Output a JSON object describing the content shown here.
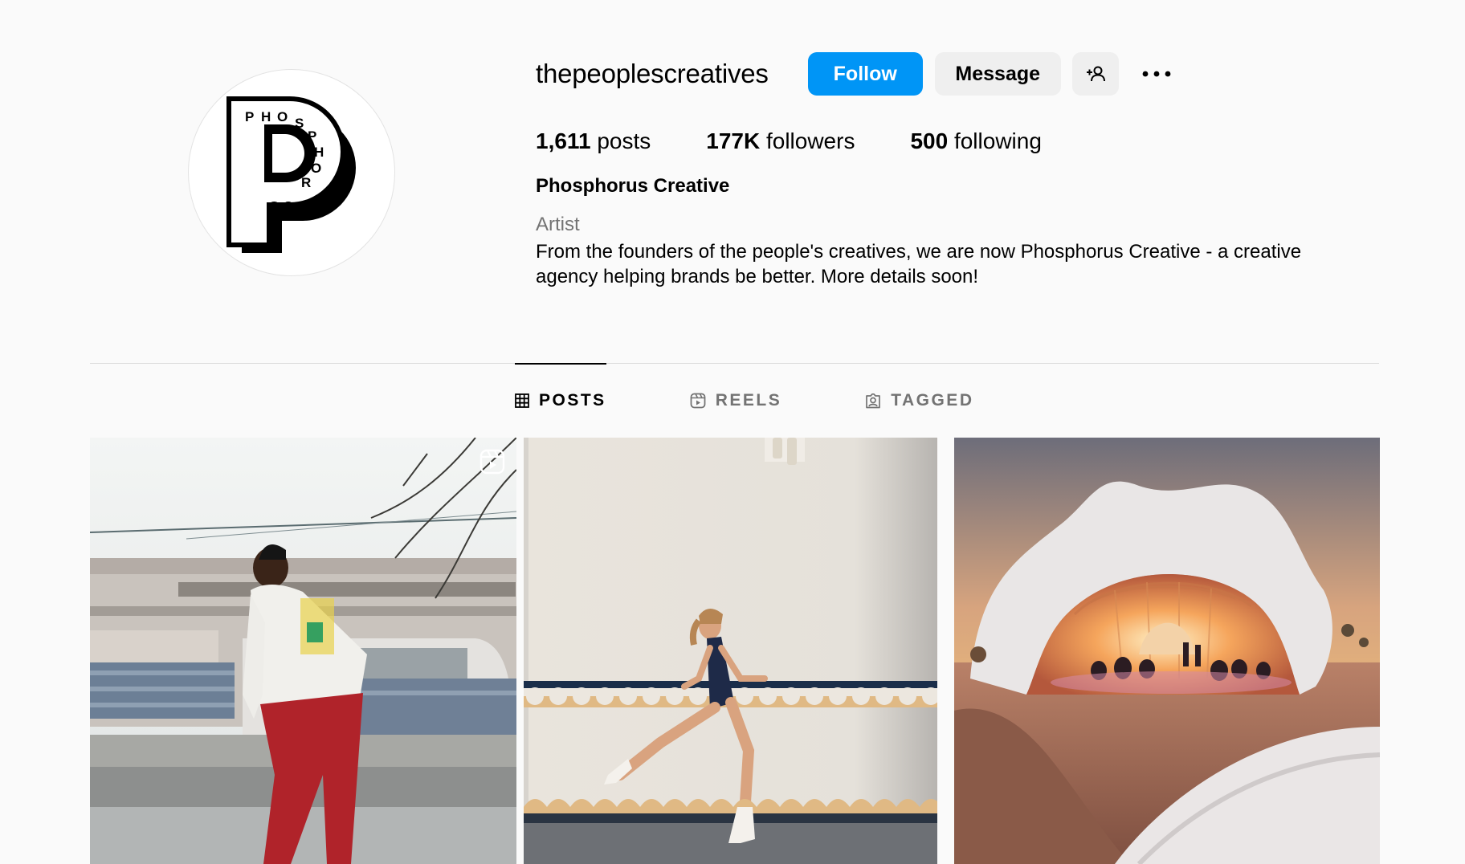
{
  "profile": {
    "username": "thepeoplescreatives",
    "avatar_logo_text": "PHOSPHORUS",
    "buttons": {
      "follow": "Follow",
      "message": "Message",
      "add_user_icon": "person-plus-icon",
      "more_icon": "more-horizontal-icon"
    },
    "stats": {
      "posts_count": "1,611",
      "posts_label": "posts",
      "followers_count": "177K",
      "followers_label": "followers",
      "following_count": "500",
      "following_label": "following"
    },
    "full_name": "Phosphorus Creative",
    "category": "Artist",
    "bio": "From the founders of the people's creatives, we are now Phosphorus Creative - a creative agency helping brands be better. More details soon!"
  },
  "tabs": [
    {
      "label": "POSTS",
      "icon": "grid-icon",
      "active": true
    },
    {
      "label": "REELS",
      "icon": "reels-icon",
      "active": false
    },
    {
      "label": "TAGGED",
      "icon": "tagged-icon",
      "active": false
    }
  ],
  "posts": [
    {
      "kind": "reel",
      "badge_icon": "reel-badge-icon"
    },
    {
      "kind": "image"
    },
    {
      "kind": "image"
    }
  ],
  "colors": {
    "accent": "#0095f6",
    "background": "#fafafa",
    "secondary_text": "#737373",
    "button_gray": "#efefef"
  }
}
